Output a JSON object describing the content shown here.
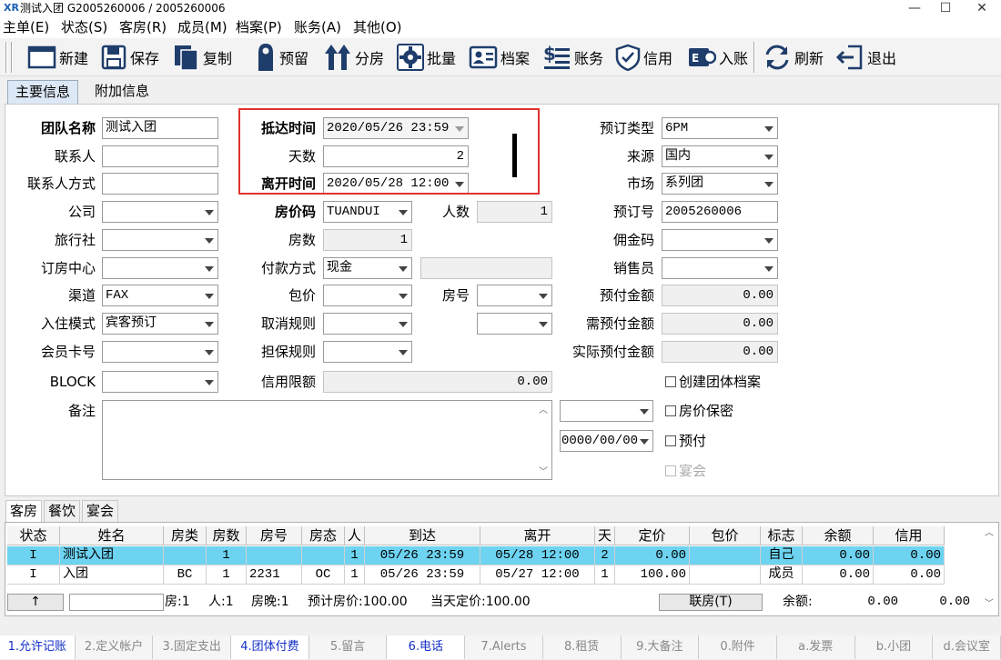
{
  "window": {
    "title": "测试入团  G2005260006  /  2005260006"
  },
  "menu": [
    "主单(E)",
    "状态(S)",
    "客房(R)",
    "成员(M)",
    "档案(P)",
    "账务(A)",
    "其他(O)"
  ],
  "toolbar": {
    "new": "新建",
    "save": "保存",
    "copy": "复制",
    "reserve": "预留",
    "assign": "分房",
    "batch": "批量",
    "profile": "档案",
    "billing": "账务",
    "credit": "信用",
    "post": "入账",
    "refresh": "刷新",
    "exit": "退出"
  },
  "tabs": {
    "main": "主要信息",
    "extra": "附加信息"
  },
  "form": {
    "group_name_label": "团队名称",
    "group_name": "测试入团",
    "contact_label": "联系人",
    "contact": "",
    "contact_method_label": "联系人方式",
    "contact_method": "",
    "company_label": "公司",
    "company": "",
    "agency_label": "旅行社",
    "agency": "",
    "booking_center_label": "订房中心",
    "booking_center": "",
    "channel_label": "渠道",
    "channel": "FAX",
    "stay_mode_label": "入住模式",
    "stay_mode": "宾客预订",
    "member_card_label": "会员卡号",
    "member_card": "",
    "block_label": "BLOCK",
    "block": "",
    "remark_label": "备注",
    "remark": "",
    "arrival_label": "抵达时间",
    "arrival": "2020/05/26 23:59",
    "days_label": "天数",
    "days": "2",
    "departure_label": "离开时间",
    "departure": "2020/05/28 12:00",
    "rate_code_label": "房价码",
    "rate_code": "TUANDUI",
    "persons_label": "人数",
    "persons": "1",
    "rooms_label": "房数",
    "rooms": "1",
    "payment_label": "付款方式",
    "payment": "现金",
    "package_label": "包价",
    "package": "",
    "room_no_label": "房号",
    "room_no": "",
    "cancel_rule_label": "取消规则",
    "cancel_rule": "",
    "guarantee_label": "担保规则",
    "guarantee": "",
    "credit_limit_label": "信用限额",
    "credit_limit": "0.00",
    "booking_type_label": "预订类型",
    "booking_type": "6PM",
    "source_label": "来源",
    "source": "国内",
    "market_label": "市场",
    "market": "系列团",
    "booking_no_label": "预订号",
    "booking_no": "2005260006",
    "commission_label": "佣金码",
    "commission": "",
    "sales_label": "销售员",
    "sales": "",
    "deposit_label": "预付金额",
    "deposit": "0.00",
    "need_deposit_label": "需预付金额",
    "need_deposit": "0.00",
    "actual_deposit_label": "实际预付金额",
    "actual_deposit": "0.00",
    "date_field": "0000/00/00",
    "create_profile": "创建团体档案",
    "rate_confidential": "房价保密",
    "prepay": "预付",
    "banquet": "宴会"
  },
  "lower_tabs": [
    "客房",
    "餐饮",
    "宴会"
  ],
  "table": {
    "headers": [
      "状态",
      "姓名",
      "房类",
      "房数",
      "房号",
      "房态",
      "人",
      "到达",
      "离开",
      "天",
      "定价",
      "包价",
      "标志",
      "余额",
      "信用"
    ],
    "rows": [
      [
        "I",
        "测试入团",
        "",
        "1",
        "",
        "",
        "1",
        "05/26 23:59",
        "05/28 12:00",
        "2",
        "0.00",
        "",
        "自己",
        "0.00",
        "0.00"
      ],
      [
        "I",
        "入团",
        "BC",
        "1",
        "2231",
        "OC",
        "1",
        "05/26 23:59",
        "05/27 12:00",
        "1",
        "100.00",
        "",
        "成员",
        "0.00",
        "0.00"
      ]
    ]
  },
  "summary": {
    "up": "↑",
    "rooms": "房:1",
    "persons": "人:1",
    "nights": "房晚:1",
    "est_rate": "预计房价:100.00",
    "today_rate": "当天定价:100.00",
    "link_btn": "联房(T)",
    "balance_label": "余额:",
    "balance": "0.00",
    "balance2": "0.00"
  },
  "bottom": [
    "1.允许记账",
    "2.定义帐户",
    "3.固定支出",
    "4.团体付费",
    "5.留言",
    "6.电话",
    "7.Alerts",
    "8.租赁",
    "9.大备注",
    "0.附件",
    "a.发票",
    "b.小团",
    "d.会议室"
  ],
  "colors": {
    "selected_row": "#6dd3f1",
    "highlight_box": "#e0332f",
    "accent": "#1a5fb4"
  }
}
